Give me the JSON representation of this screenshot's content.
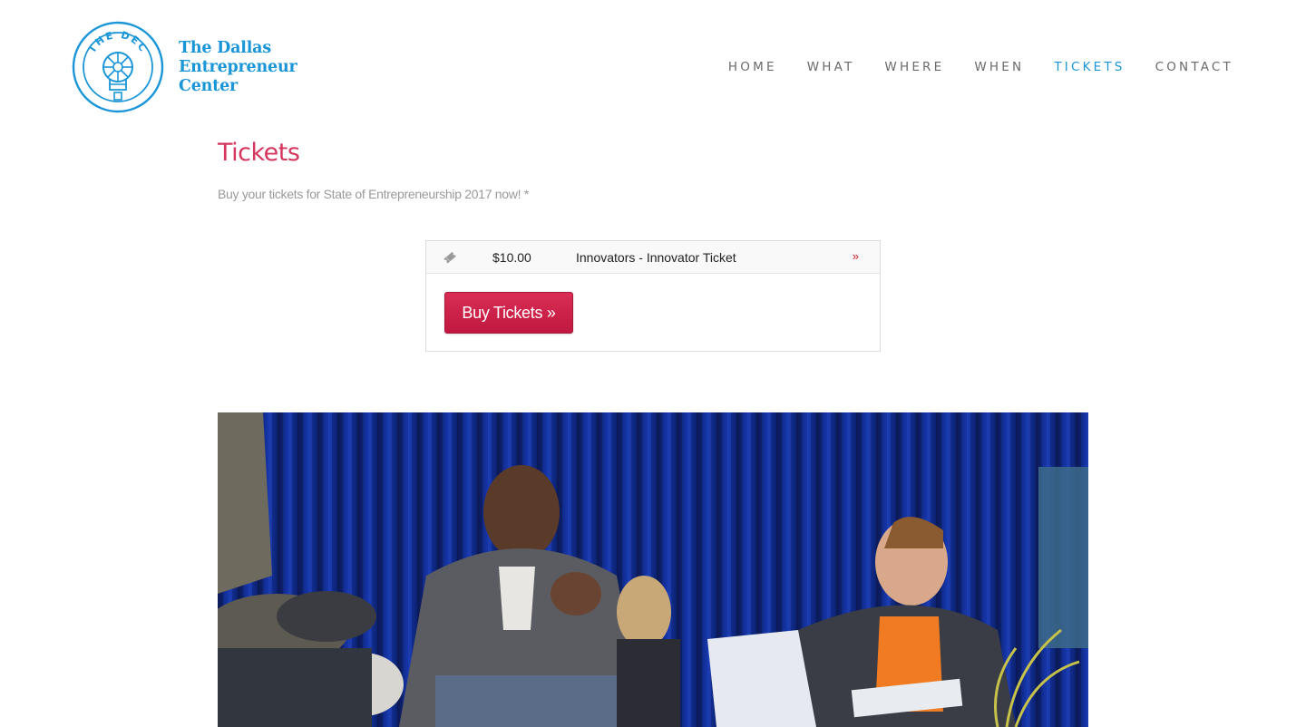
{
  "logo": {
    "badge_text": "THE DEC",
    "line1": "The Dallas",
    "line2": "Entrepreneur",
    "line3": "Center"
  },
  "nav": [
    {
      "label": "HOME",
      "active": false
    },
    {
      "label": "WHAT",
      "active": false
    },
    {
      "label": "WHERE",
      "active": false
    },
    {
      "label": "WHEN",
      "active": false
    },
    {
      "label": "TICKETS",
      "active": true
    },
    {
      "label": "CONTACT",
      "active": false
    }
  ],
  "page": {
    "title": "Tickets",
    "intro": "Buy your tickets for State of Entrepreneurship 2017 now! *"
  },
  "ticket": {
    "icon": "ticket-icon",
    "price": "$10.00",
    "name": "Innovators - Innovator Ticket",
    "more": "»",
    "button_label": "Buy Tickets »"
  },
  "colors": {
    "brand_blue": "#1a96d8",
    "title_pink": "#d4365e",
    "button_red": "#c8214a"
  }
}
